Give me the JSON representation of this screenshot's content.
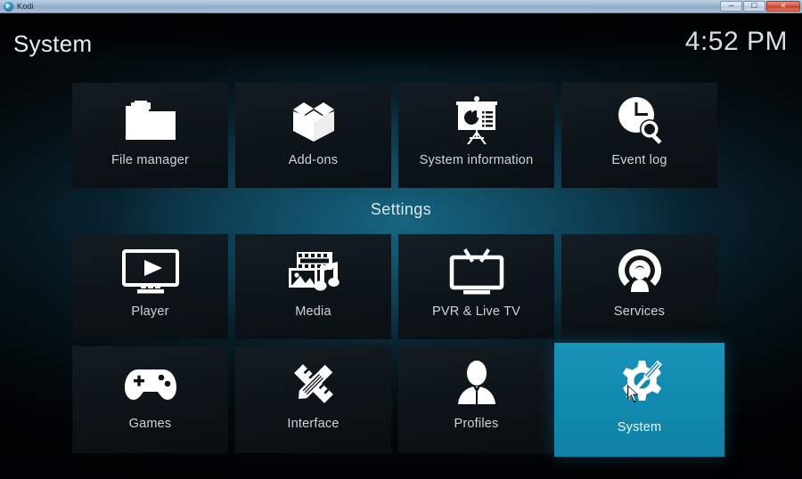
{
  "window": {
    "app_title": "Kodi",
    "logo_icon": "kodi-logo-icon",
    "minimize_glyph": "—",
    "maximize_glyph": "❐",
    "close_glyph": "✕"
  },
  "header": {
    "page_title": "System",
    "clock": "4:52 PM"
  },
  "separator": {
    "label": "Settings"
  },
  "colors": {
    "selected_tile": "#1187ad",
    "tile_background": "#111920",
    "label_text": "#cdd5da",
    "glow": "#176986"
  },
  "grid": {
    "top_row": [
      {
        "label": "File manager",
        "icon": "folder-icon",
        "selected": false
      },
      {
        "label": "Add-ons",
        "icon": "open-box-icon",
        "selected": false
      },
      {
        "label": "System information",
        "icon": "presentation-board-icon",
        "selected": false
      },
      {
        "label": "Event log",
        "icon": "clock-search-icon",
        "selected": false
      }
    ],
    "middle_row": [
      {
        "label": "Player",
        "icon": "monitor-play-icon",
        "selected": false
      },
      {
        "label": "Media",
        "icon": "film-photo-music-icon",
        "selected": false
      },
      {
        "label": "PVR & Live TV",
        "icon": "tv-antenna-icon",
        "selected": false
      },
      {
        "label": "Services",
        "icon": "broadcast-person-icon",
        "selected": false
      }
    ],
    "bottom_row": [
      {
        "label": "Games",
        "icon": "gamepad-icon",
        "selected": false
      },
      {
        "label": "Interface",
        "icon": "pencil-ruler-icon",
        "selected": false
      },
      {
        "label": "Profiles",
        "icon": "person-bust-icon",
        "selected": false
      },
      {
        "label": "System",
        "icon": "gear-screwdriver-icon",
        "selected": true
      }
    ]
  },
  "pointer": {
    "icon": "mouse-cursor-icon"
  }
}
